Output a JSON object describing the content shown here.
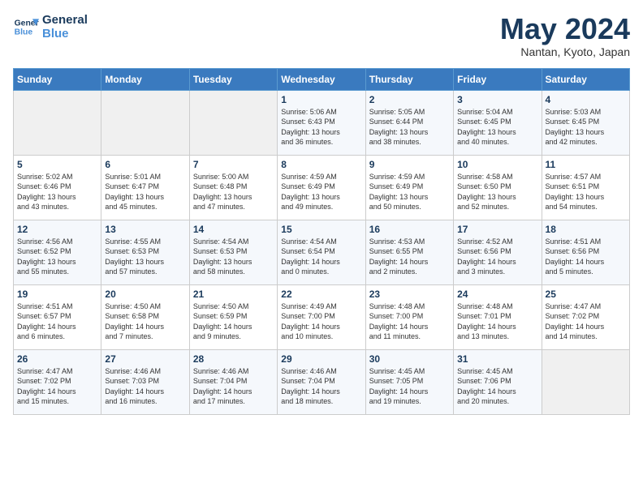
{
  "header": {
    "logo_line1": "General",
    "logo_line2": "Blue",
    "month_title": "May 2024",
    "location": "Nantan, Kyoto, Japan"
  },
  "weekdays": [
    "Sunday",
    "Monday",
    "Tuesday",
    "Wednesday",
    "Thursday",
    "Friday",
    "Saturday"
  ],
  "weeks": [
    [
      {
        "day": "",
        "info": ""
      },
      {
        "day": "",
        "info": ""
      },
      {
        "day": "",
        "info": ""
      },
      {
        "day": "1",
        "info": "Sunrise: 5:06 AM\nSunset: 6:43 PM\nDaylight: 13 hours\nand 36 minutes."
      },
      {
        "day": "2",
        "info": "Sunrise: 5:05 AM\nSunset: 6:44 PM\nDaylight: 13 hours\nand 38 minutes."
      },
      {
        "day": "3",
        "info": "Sunrise: 5:04 AM\nSunset: 6:45 PM\nDaylight: 13 hours\nand 40 minutes."
      },
      {
        "day": "4",
        "info": "Sunrise: 5:03 AM\nSunset: 6:45 PM\nDaylight: 13 hours\nand 42 minutes."
      }
    ],
    [
      {
        "day": "5",
        "info": "Sunrise: 5:02 AM\nSunset: 6:46 PM\nDaylight: 13 hours\nand 43 minutes."
      },
      {
        "day": "6",
        "info": "Sunrise: 5:01 AM\nSunset: 6:47 PM\nDaylight: 13 hours\nand 45 minutes."
      },
      {
        "day": "7",
        "info": "Sunrise: 5:00 AM\nSunset: 6:48 PM\nDaylight: 13 hours\nand 47 minutes."
      },
      {
        "day": "8",
        "info": "Sunrise: 4:59 AM\nSunset: 6:49 PM\nDaylight: 13 hours\nand 49 minutes."
      },
      {
        "day": "9",
        "info": "Sunrise: 4:59 AM\nSunset: 6:49 PM\nDaylight: 13 hours\nand 50 minutes."
      },
      {
        "day": "10",
        "info": "Sunrise: 4:58 AM\nSunset: 6:50 PM\nDaylight: 13 hours\nand 52 minutes."
      },
      {
        "day": "11",
        "info": "Sunrise: 4:57 AM\nSunset: 6:51 PM\nDaylight: 13 hours\nand 54 minutes."
      }
    ],
    [
      {
        "day": "12",
        "info": "Sunrise: 4:56 AM\nSunset: 6:52 PM\nDaylight: 13 hours\nand 55 minutes."
      },
      {
        "day": "13",
        "info": "Sunrise: 4:55 AM\nSunset: 6:53 PM\nDaylight: 13 hours\nand 57 minutes."
      },
      {
        "day": "14",
        "info": "Sunrise: 4:54 AM\nSunset: 6:53 PM\nDaylight: 13 hours\nand 58 minutes."
      },
      {
        "day": "15",
        "info": "Sunrise: 4:54 AM\nSunset: 6:54 PM\nDaylight: 14 hours\nand 0 minutes."
      },
      {
        "day": "16",
        "info": "Sunrise: 4:53 AM\nSunset: 6:55 PM\nDaylight: 14 hours\nand 2 minutes."
      },
      {
        "day": "17",
        "info": "Sunrise: 4:52 AM\nSunset: 6:56 PM\nDaylight: 14 hours\nand 3 minutes."
      },
      {
        "day": "18",
        "info": "Sunrise: 4:51 AM\nSunset: 6:56 PM\nDaylight: 14 hours\nand 5 minutes."
      }
    ],
    [
      {
        "day": "19",
        "info": "Sunrise: 4:51 AM\nSunset: 6:57 PM\nDaylight: 14 hours\nand 6 minutes."
      },
      {
        "day": "20",
        "info": "Sunrise: 4:50 AM\nSunset: 6:58 PM\nDaylight: 14 hours\nand 7 minutes."
      },
      {
        "day": "21",
        "info": "Sunrise: 4:50 AM\nSunset: 6:59 PM\nDaylight: 14 hours\nand 9 minutes."
      },
      {
        "day": "22",
        "info": "Sunrise: 4:49 AM\nSunset: 7:00 PM\nDaylight: 14 hours\nand 10 minutes."
      },
      {
        "day": "23",
        "info": "Sunrise: 4:48 AM\nSunset: 7:00 PM\nDaylight: 14 hours\nand 11 minutes."
      },
      {
        "day": "24",
        "info": "Sunrise: 4:48 AM\nSunset: 7:01 PM\nDaylight: 14 hours\nand 13 minutes."
      },
      {
        "day": "25",
        "info": "Sunrise: 4:47 AM\nSunset: 7:02 PM\nDaylight: 14 hours\nand 14 minutes."
      }
    ],
    [
      {
        "day": "26",
        "info": "Sunrise: 4:47 AM\nSunset: 7:02 PM\nDaylight: 14 hours\nand 15 minutes."
      },
      {
        "day": "27",
        "info": "Sunrise: 4:46 AM\nSunset: 7:03 PM\nDaylight: 14 hours\nand 16 minutes."
      },
      {
        "day": "28",
        "info": "Sunrise: 4:46 AM\nSunset: 7:04 PM\nDaylight: 14 hours\nand 17 minutes."
      },
      {
        "day": "29",
        "info": "Sunrise: 4:46 AM\nSunset: 7:04 PM\nDaylight: 14 hours\nand 18 minutes."
      },
      {
        "day": "30",
        "info": "Sunrise: 4:45 AM\nSunset: 7:05 PM\nDaylight: 14 hours\nand 19 minutes."
      },
      {
        "day": "31",
        "info": "Sunrise: 4:45 AM\nSunset: 7:06 PM\nDaylight: 14 hours\nand 20 minutes."
      },
      {
        "day": "",
        "info": ""
      }
    ]
  ]
}
